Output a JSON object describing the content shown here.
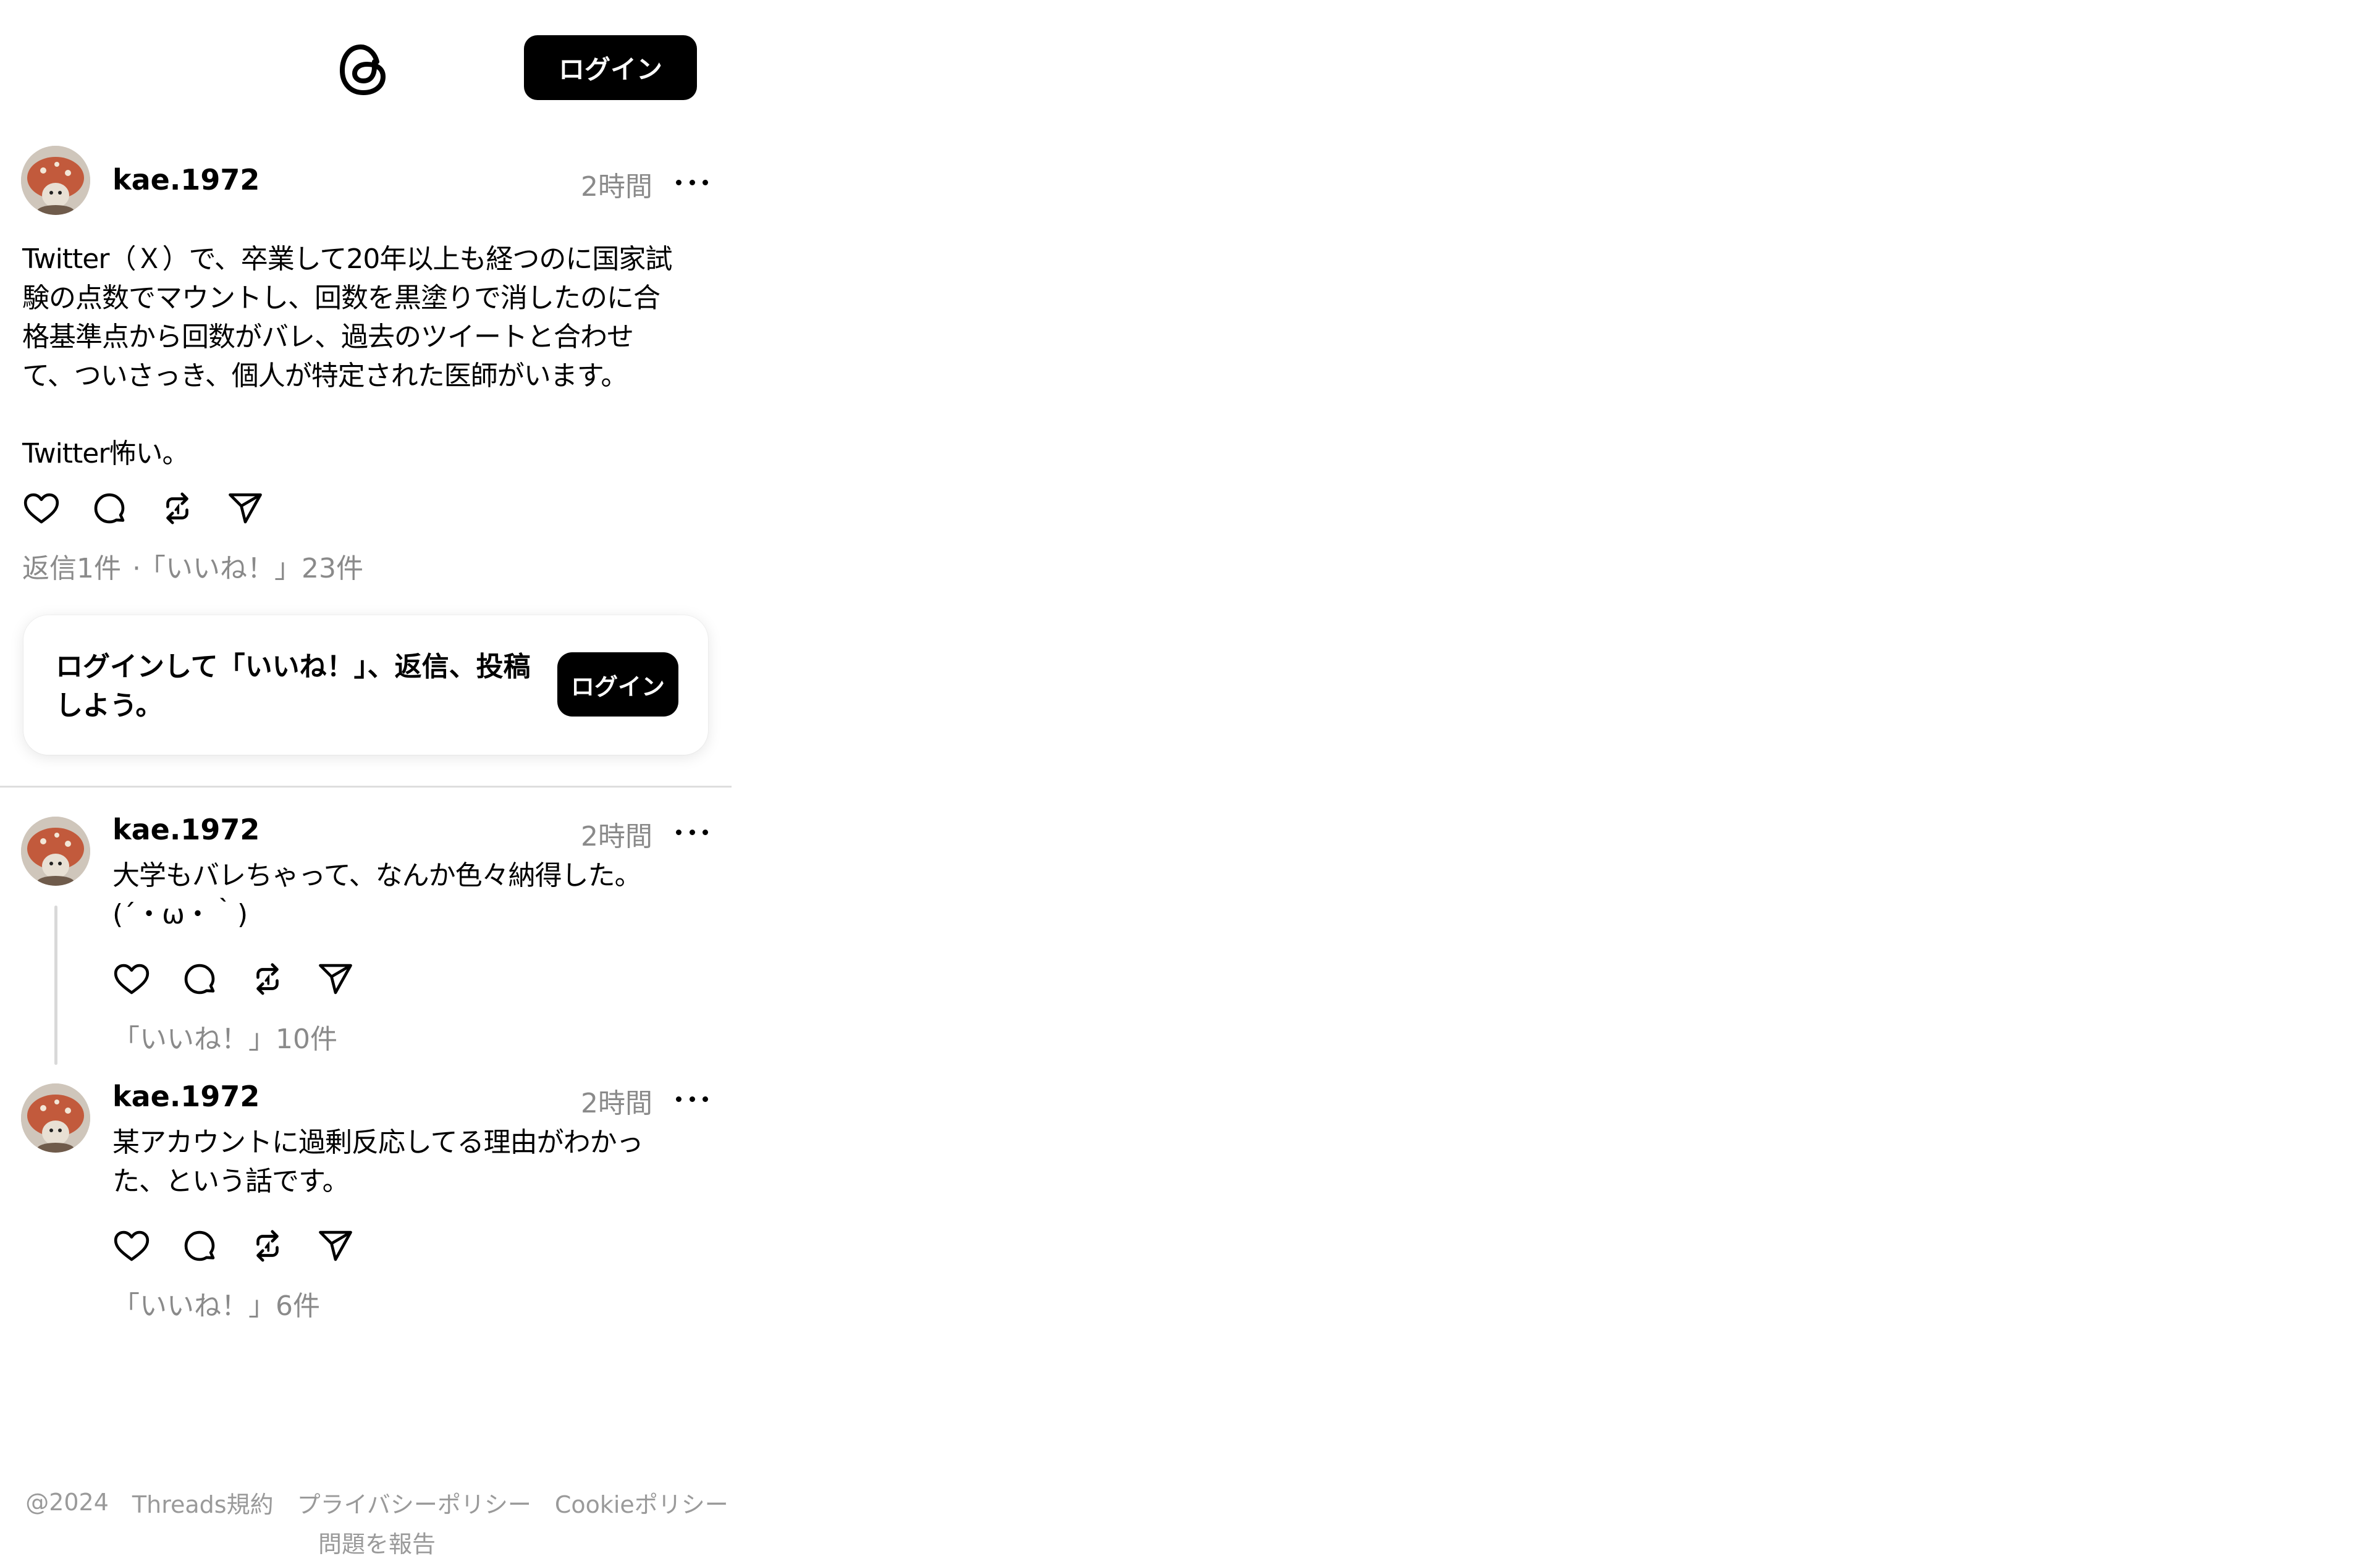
{
  "header": {
    "logo_icon": "threads-logo-icon",
    "login_label": "ログイン"
  },
  "main_post": {
    "username": "kae.1972",
    "timestamp": "2時間",
    "more_icon": "more-horizontal-icon",
    "text": "Twitter（Ｘ）で、卒業して20年以上も経つのに国家試\n験の点数でマウントし、回数を黒塗りで消したのに合\n格基準点から回数がバレ、過去のツイートと合わせ\nて、ついさっき、個人が特定された医師がいます。\n\nTwitter怖い。",
    "actions": [
      "heart-icon",
      "comment-icon",
      "repost-icon",
      "share-icon"
    ],
    "replies_count": "返信1件",
    "separator": "·",
    "likes_count": "「いいね！」23件"
  },
  "login_prompt": {
    "text": "ログインして「いいね！」、返信、投稿しよう。",
    "login_label": "ログイン"
  },
  "replies": [
    {
      "username": "kae.1972",
      "timestamp": "2時間",
      "text": "大学もバレちゃって、なんか色々納得した。\n(´・ω・｀)",
      "likes_count": "「いいね！」10件"
    },
    {
      "username": "kae.1972",
      "timestamp": "2時間",
      "text": "某アカウントに過剰反応してる理由がわかっ\nた、という話です。",
      "likes_count": "「いいね！」6件"
    }
  ],
  "footer": {
    "copyright": "@2024",
    "links": [
      "Threads規約",
      "プライバシーポリシー",
      "Cookieポリシー"
    ],
    "report": "問題を報告"
  },
  "colors": {
    "button_bg": "#000000",
    "muted_text": "#8a8a8a",
    "divider": "#dedede"
  }
}
